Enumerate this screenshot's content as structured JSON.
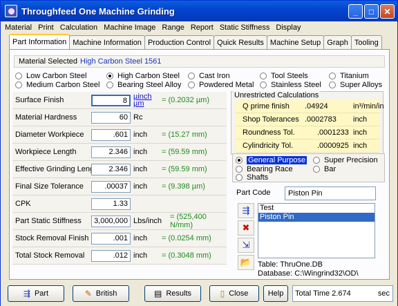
{
  "window": {
    "title": "Throughfeed One Machine Grinding"
  },
  "menu": [
    "Material",
    "Print",
    "Calculation",
    "Machine Image",
    "Range",
    "Report",
    "Static Stiffness",
    "Display"
  ],
  "tabs": [
    "Part Information",
    "Machine Information",
    "Production Control",
    "Quick Results",
    "Machine Setup",
    "Graph",
    "Tooling"
  ],
  "material": {
    "label": "Material Selected",
    "value": "High Carbon Steel  1561",
    "options": [
      "Low Carbon Steel",
      "High Carbon Steel",
      "Cast Iron",
      "Tool Steels",
      "Titanium",
      "Medium Carbon Steel",
      "Bearing Steel Alloy",
      "Powdered Metal",
      "Stainless Steel",
      "Super Alloys"
    ],
    "selected": "High Carbon Steel"
  },
  "params": [
    {
      "label": "Surface Finish",
      "value": "8",
      "unit": "µinch µm",
      "metric": "= (0.2032  µm)"
    },
    {
      "label": "Material Hardness",
      "value": "60",
      "unit": "Rc",
      "metric": ""
    },
    {
      "label": "Diameter Workpiece",
      "value": ".601",
      "unit": "inch",
      "metric": "= (15.27  mm)"
    },
    {
      "label": "Workpiece Length",
      "value": "2.346",
      "unit": "inch",
      "metric": "= (59.59  mm)"
    },
    {
      "label": "Effective Grinding Length",
      "value": "2.346",
      "unit": "inch",
      "metric": "= (59.59  mm)"
    },
    {
      "label": "Final Size Tolerance",
      "value": ".00037",
      "unit": "inch",
      "metric": "= (9.398  µm)"
    },
    {
      "label": "CPK",
      "value": "1.33",
      "unit": "",
      "metric": ""
    },
    {
      "label": "Part Static Stiffness",
      "value": "3,000,000",
      "unit": "Lbs/inch",
      "metric": "= (525,400  N/mm)"
    },
    {
      "label": "Stock Removal Finish",
      "value": ".001",
      "unit": "inch",
      "metric": "= (0.0254  mm)"
    },
    {
      "label": "Total Stock Removal",
      "value": ".012",
      "unit": "inch",
      "metric": "= (0.3048  mm)"
    }
  ],
  "calc": {
    "header": "Unrestricted Calculations",
    "rows": [
      {
        "label": "Q prime finish",
        "value": ".04924",
        "unit": "in³/min/in"
      },
      {
        "label": "Shop Tolerances",
        "value": ".0002783",
        "unit": "inch"
      },
      {
        "label": "Roundness Tol.",
        "value": ".0001233",
        "unit": "inch"
      },
      {
        "label": "Cylindricity Tol.",
        "value": ".0000925",
        "unit": "inch"
      }
    ]
  },
  "purpose": {
    "options": [
      "General Purpose",
      "Super Precision",
      "Bearing Race",
      "Bar",
      "Shafts"
    ],
    "selected": "General Purpose"
  },
  "part": {
    "label": "Part Code",
    "value": "Piston Pin",
    "list": [
      "Test",
      "Piston Pin"
    ],
    "selected": "Piston Pin",
    "table": "Table: ThruOne.DB",
    "database": "Database: C:\\Wingrind32\\OD\\"
  },
  "buttons": {
    "part": "Part",
    "british": "British",
    "results": "Results",
    "close": "Close",
    "help": "Help"
  },
  "total": {
    "label": "Total Time 2.674",
    "unit": "sec"
  }
}
